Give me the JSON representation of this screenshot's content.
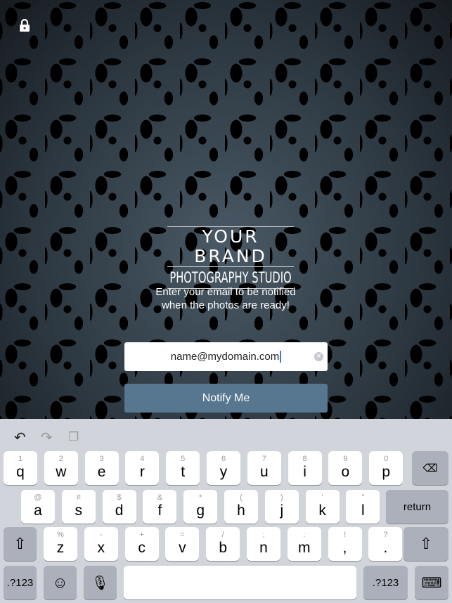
{
  "brand": {
    "line1": "YOUR BRAND",
    "line2": "PHOTOGRAPHY STUDIO"
  },
  "message": {
    "line1": "Enter your email to be notified",
    "line2": "when the photos are ready!"
  },
  "email": {
    "value": "name@mydomain.com"
  },
  "notify_label": "Notify Me",
  "colors": {
    "button": "#57768f",
    "keyboard": "#d1d4da"
  },
  "keyboard": {
    "toolbar": [
      "undo-icon",
      "redo-icon",
      "paste-icon"
    ],
    "row1": [
      [
        "q",
        "1"
      ],
      [
        "w",
        "2"
      ],
      [
        "e",
        "3"
      ],
      [
        "r",
        "4"
      ],
      [
        "t",
        "5"
      ],
      [
        "y",
        "6"
      ],
      [
        "u",
        "7"
      ],
      [
        "i",
        "8"
      ],
      [
        "o",
        "9"
      ],
      [
        "p",
        "0"
      ]
    ],
    "row2": [
      [
        "a",
        "@"
      ],
      [
        "s",
        "#"
      ],
      [
        "d",
        "$"
      ],
      [
        "f",
        "&"
      ],
      [
        "g",
        "*"
      ],
      [
        "h",
        "("
      ],
      [
        "j",
        ")"
      ],
      [
        "k",
        "'"
      ],
      [
        "l",
        "\""
      ]
    ],
    "row3": [
      [
        "z",
        "%"
      ],
      [
        "x",
        "-"
      ],
      [
        "c",
        "+"
      ],
      [
        "v",
        "="
      ],
      [
        "b",
        "/"
      ],
      [
        "n",
        ";"
      ],
      [
        "m",
        ":"
      ],
      [
        ",",
        "!"
      ],
      [
        ".",
        "?"
      ]
    ],
    "return_label": "return",
    "numbers_label": ".?123"
  }
}
